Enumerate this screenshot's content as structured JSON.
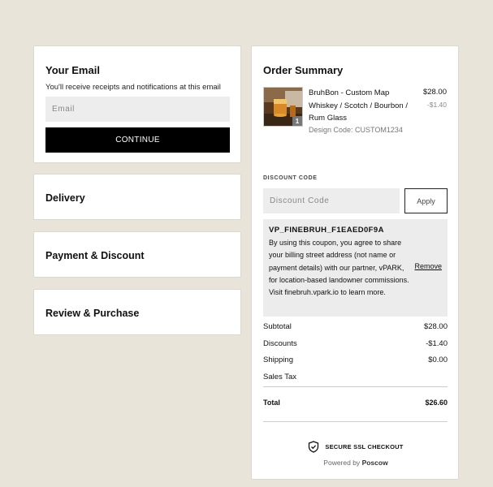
{
  "email_section": {
    "title": "Your Email",
    "note": "You'll receive receipts and notifications at this email",
    "placeholder": "Email",
    "continue_label": "CONTINUE"
  },
  "sections": {
    "delivery": "Delivery",
    "payment": "Payment & Discount",
    "review": "Review & Purchase"
  },
  "summary": {
    "title": "Order Summary",
    "item": {
      "name": "BruhBon - Custom Map Whiskey / Scotch / Bourbon / Rum Glass",
      "design_code": "Design Code: CUSTOM1234",
      "price": "$28.00",
      "discount": "-$1.40",
      "quantity": "1",
      "thumbnail_icon": "whiskey-glass-image"
    },
    "discount_label": "DISCOUNT CODE",
    "discount_placeholder": "Discount Code",
    "apply_label": "Apply",
    "coupon": {
      "code": "VP_FINEBRUH_F1EAED0F9A",
      "text": "By using this coupon, you agree to share your billing street address (not name or payment details) with our partner, vPARK, for location-based landowner commissions. Visit finebruh.vpark.io to learn more.",
      "remove_label": "Remove"
    },
    "totals": [
      {
        "label": "Subtotal",
        "value": "$28.00"
      },
      {
        "label": "Discounts",
        "value": "-$1.40"
      },
      {
        "label": "Shipping",
        "value": "$0.00"
      },
      {
        "label": "Sales Tax",
        "value": ""
      }
    ],
    "total_label": "Total",
    "total_value": "$26.60",
    "ssl_label": "SECURE SSL CHECKOUT",
    "powered_prefix": "Powered by",
    "powered_brand": "Poscow"
  },
  "colors": {
    "page_bg": "#e8e4da",
    "button_bg": "#000000",
    "input_bg": "#ededed"
  }
}
